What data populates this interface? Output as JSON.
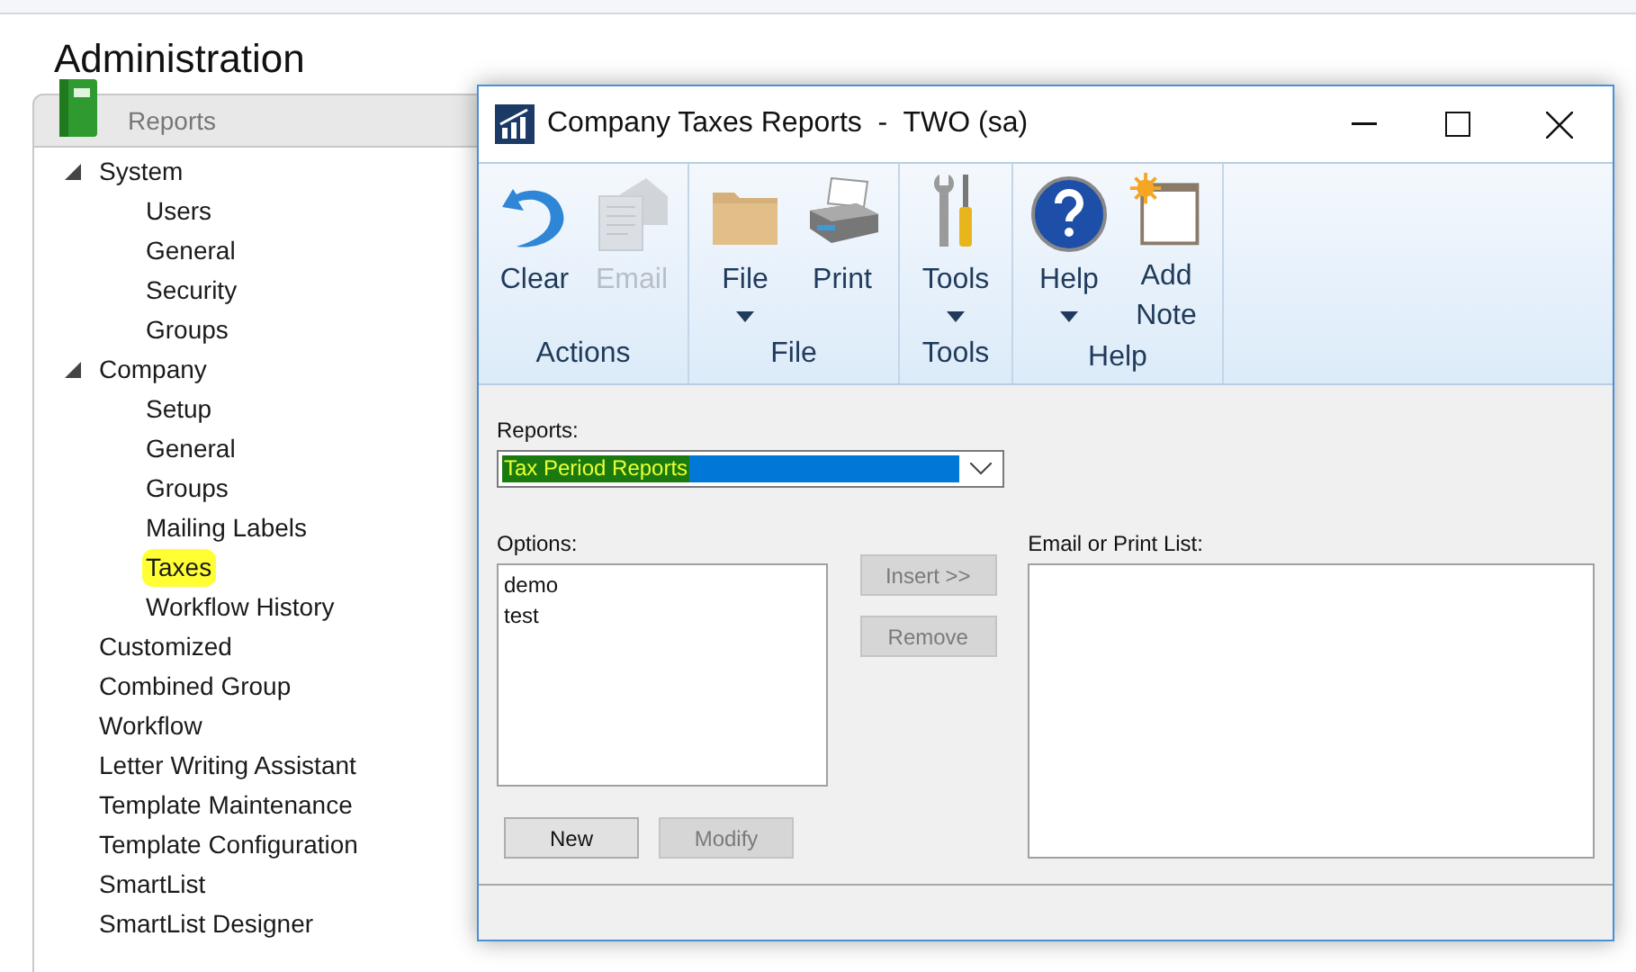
{
  "page": {
    "title": "Administration"
  },
  "panel": {
    "tab": "Reports"
  },
  "tree": [
    {
      "label": "System",
      "expanded": true,
      "highlighted": false,
      "children": [
        {
          "label": "Users",
          "highlighted": false
        },
        {
          "label": "General",
          "highlighted": false
        },
        {
          "label": "Security",
          "highlighted": false
        },
        {
          "label": "Groups",
          "highlighted": false
        }
      ]
    },
    {
      "label": "Company",
      "expanded": true,
      "highlighted": false,
      "children": [
        {
          "label": "Setup",
          "highlighted": false
        },
        {
          "label": "General",
          "highlighted": false
        },
        {
          "label": "Groups",
          "highlighted": false
        },
        {
          "label": "Mailing Labels",
          "highlighted": false
        },
        {
          "label": "Taxes",
          "highlighted": true
        },
        {
          "label": "Workflow History",
          "highlighted": false
        }
      ]
    },
    {
      "label": "Customized",
      "highlighted": false
    },
    {
      "label": "Combined Group",
      "highlighted": false
    },
    {
      "label": "Workflow",
      "highlighted": false
    },
    {
      "label": "Letter Writing Assistant",
      "highlighted": false
    },
    {
      "label": "Template Maintenance",
      "highlighted": false
    },
    {
      "label": "Template Configuration",
      "highlighted": false
    },
    {
      "label": "SmartList",
      "highlighted": false
    },
    {
      "label": "SmartList Designer",
      "highlighted": false
    }
  ],
  "dialog": {
    "title": "Company Taxes Reports  -  TWO (sa)",
    "ribbon": [
      {
        "group": "Actions",
        "buttons": [
          {
            "kind": "undo",
            "label": "Clear",
            "disabled": false,
            "menu": false
          },
          {
            "kind": "email",
            "label": "Email",
            "disabled": true,
            "menu": false
          }
        ]
      },
      {
        "group": "File",
        "buttons": [
          {
            "kind": "folder",
            "label": "File",
            "disabled": false,
            "menu": true
          },
          {
            "kind": "printer",
            "label": "Print",
            "disabled": false,
            "menu": false
          }
        ]
      },
      {
        "group": "Tools",
        "buttons": [
          {
            "kind": "tools",
            "label": "Tools",
            "disabled": false,
            "menu": true
          }
        ]
      },
      {
        "group": "Help",
        "buttons": [
          {
            "kind": "help",
            "label": "Help",
            "disabled": false,
            "menu": true
          },
          {
            "kind": "note",
            "label": "Add Note",
            "disabled": false,
            "menu": false
          }
        ]
      }
    ],
    "reports_label": "Reports:",
    "reports": {
      "value": "Tax Period Reports",
      "highlighted": true
    },
    "options_label": "Options:",
    "options": [
      "demo",
      "test"
    ],
    "insert_button": {
      "label": "Insert >>",
      "disabled": true
    },
    "remove_button": {
      "label": "Remove",
      "disabled": true
    },
    "new_button": {
      "label": "New",
      "disabled": false
    },
    "modify_button": {
      "label": "Modify",
      "disabled": true
    },
    "list_label": "Email or Print List:"
  }
}
